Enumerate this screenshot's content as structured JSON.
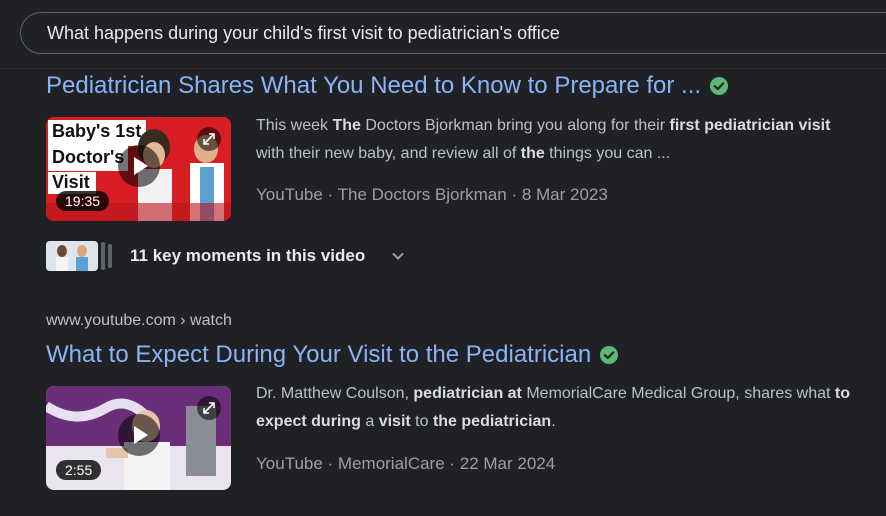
{
  "search": {
    "query": "What happens during your child's first visit to pediatrician's office"
  },
  "results": [
    {
      "title": "Pediatrician Shares What You Need to Know to Prepare for ...",
      "thumbnail_text": [
        "Baby's 1st",
        "Doctor's",
        "Visit"
      ],
      "duration": "19:35",
      "snippet_parts": [
        {
          "text": "This week ",
          "bold": false
        },
        {
          "text": "The",
          "bold": true
        },
        {
          "text": " Doctors Bjorkman bring you along for their ",
          "bold": false
        },
        {
          "text": "first pediatrician visit",
          "bold": true
        },
        {
          "text": " with their new baby, and review all of ",
          "bold": false
        },
        {
          "text": "the",
          "bold": true
        },
        {
          "text": " things you can ...",
          "bold": false
        }
      ],
      "source": "YouTube · The Doctors Bjorkman · 8 Mar 2023",
      "key_moments": "11 key moments in this video"
    },
    {
      "url": "www.youtube.com › watch",
      "title": "What to Expect During Your Visit to the Pediatrician",
      "duration": "2:55",
      "snippet_parts": [
        {
          "text": "Dr. Matthew Coulson, ",
          "bold": false
        },
        {
          "text": "pediatrician at",
          "bold": true
        },
        {
          "text": " MemorialCare Medical Group, shares what ",
          "bold": false
        },
        {
          "text": "to expect during",
          "bold": true
        },
        {
          "text": " a ",
          "bold": false
        },
        {
          "text": "visit",
          "bold": true
        },
        {
          "text": " to ",
          "bold": false
        },
        {
          "text": "the pediatrician",
          "bold": true
        },
        {
          "text": ".",
          "bold": false
        }
      ],
      "source": "YouTube · MemorialCare · 22 Mar 2024"
    }
  ],
  "icons": {
    "verified": "verified-check-icon",
    "play": "play-icon",
    "expand": "expand-icon",
    "chevron": "chevron-down-icon"
  },
  "colors": {
    "link": "#8ab4f8",
    "verified": "#34a853",
    "background": "#202124"
  }
}
